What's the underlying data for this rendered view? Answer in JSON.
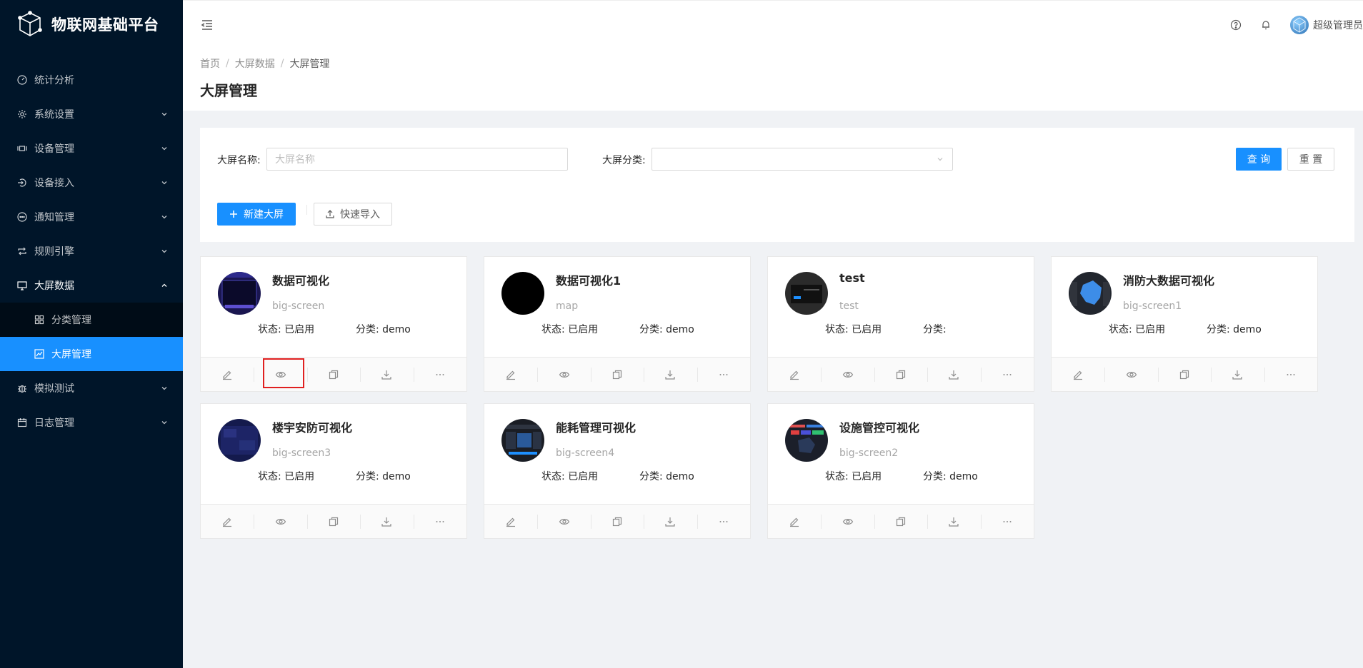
{
  "app": {
    "title": "物联网基础平台"
  },
  "sidebar": {
    "items": [
      {
        "label": "统计分析",
        "icon": "dashboard-icon"
      },
      {
        "label": "系统设置",
        "icon": "gear-icon"
      },
      {
        "label": "设备管理",
        "icon": "device-icon"
      },
      {
        "label": "设备接入",
        "icon": "login-icon"
      },
      {
        "label": "通知管理",
        "icon": "message-icon"
      },
      {
        "label": "规则引擎",
        "icon": "retweet-icon"
      },
      {
        "label": "大屏数据",
        "icon": "desktop-icon"
      },
      {
        "label": "模拟测试",
        "icon": "bug-icon"
      },
      {
        "label": "日志管理",
        "icon": "calendar-icon"
      }
    ],
    "sub_items": [
      {
        "label": "分类管理",
        "icon": "appstore-icon"
      },
      {
        "label": "大屏管理",
        "icon": "chart-icon"
      }
    ]
  },
  "header": {
    "user_name": "超级管理员"
  },
  "breadcrumb": [
    "首页",
    "大屏数据",
    "大屏管理"
  ],
  "page": {
    "title": "大屏管理"
  },
  "filter": {
    "name_label": "大屏名称:",
    "name_placeholder": "大屏名称",
    "category_label": "大屏分类:",
    "category_value": "",
    "query_label": "查 询",
    "reset_label": "重 置",
    "new_label": "新建大屏",
    "import_label": "快速导入"
  },
  "cards": [
    {
      "title": "数据可视化",
      "code": "big-screen",
      "status": "状态: 已启用",
      "category": "分类: demo"
    },
    {
      "title": "数据可视化1",
      "code": "map",
      "status": "状态: 已启用",
      "category": "分类: demo"
    },
    {
      "title": "test",
      "code": "test",
      "status": "状态: 已启用",
      "category": "分类:"
    },
    {
      "title": "消防大数据可视化",
      "code": "big-screen1",
      "status": "状态: 已启用",
      "category": "分类: demo"
    },
    {
      "title": "楼宇安防可视化",
      "code": "big-screen3",
      "status": "状态: 已启用",
      "category": "分类: demo"
    },
    {
      "title": "能耗管理可视化",
      "code": "big-screen4",
      "status": "状态: 已启用",
      "category": "分类: demo"
    },
    {
      "title": "设施管控可视化",
      "code": "big-screen2",
      "status": "状态: 已启用",
      "category": "分类: demo"
    }
  ],
  "card_actions": [
    "edit-icon",
    "eye-icon",
    "copy-icon",
    "download-icon",
    "ellipsis-icon"
  ],
  "colors": {
    "sidebar_bg": "#001529",
    "primary": "#1890ff",
    "highlight": "#e02020"
  }
}
